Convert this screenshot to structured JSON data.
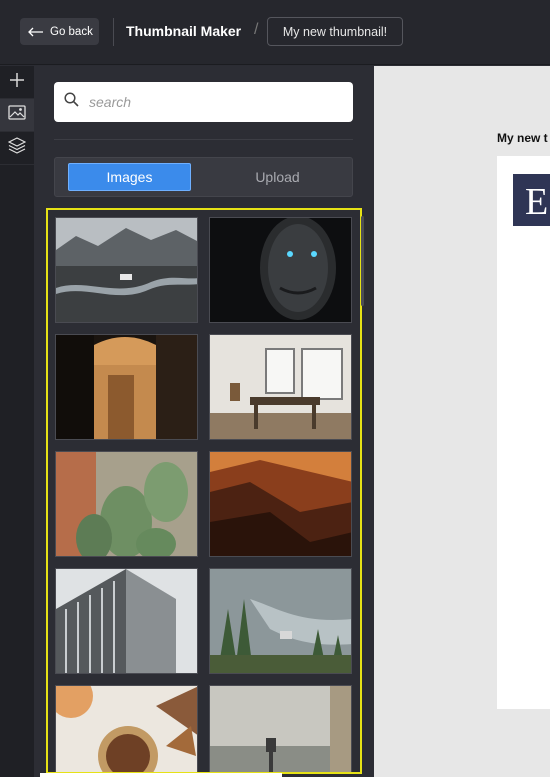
{
  "header": {
    "back_label": "Go back",
    "app_title": "Thumbnail Maker",
    "separator": "/",
    "document_name": "My new thumbnail!"
  },
  "rail": {
    "items": [
      {
        "icon": "plus-icon"
      },
      {
        "icon": "image-icon"
      },
      {
        "icon": "layers-icon"
      }
    ]
  },
  "panel": {
    "search_placeholder": "search",
    "tabs": [
      {
        "label": "Images",
        "active": true
      },
      {
        "label": "Upload",
        "active": false
      }
    ],
    "highlight_color": "#e6e216",
    "images": [
      {
        "subject": "mountain valley with river"
      },
      {
        "subject": "dark sculpted face with glowing eyes"
      },
      {
        "subject": "orange-walled corridor"
      },
      {
        "subject": "dining room interior"
      },
      {
        "subject": "cactus plant"
      },
      {
        "subject": "orange canyon at sunset"
      },
      {
        "subject": "tall building facade"
      },
      {
        "subject": "river through forest"
      },
      {
        "subject": "coffee cup on table"
      },
      {
        "subject": "viewpoint with coin binoculars"
      }
    ]
  },
  "canvas": {
    "label": "My new t",
    "block_letter": "E",
    "accent": "#2f3555"
  }
}
